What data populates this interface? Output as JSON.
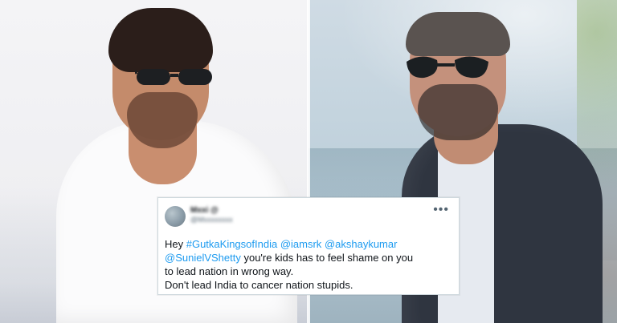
{
  "tweet": {
    "author_name": "Mxxi @",
    "author_handle": "@Mxxxxxxxx",
    "more_menu": "•••",
    "line1": {
      "prefix": "Hey ",
      "hashtag": "#GutkaKingsofIndia",
      "sep1": " ",
      "mention1": "@iamsrk",
      "sep2": " ",
      "mention2": "@akshaykumar"
    },
    "line2": {
      "mention": "@SunielVShetty",
      "rest": "  you're kids has to feel shame on you"
    },
    "line3": "to lead nation in wrong way.",
    "line4": "Don't lead India to cancer nation stupids."
  },
  "colors": {
    "link_blue": "#1d9bf0",
    "text_dark": "#0f1419",
    "text_gray": "#536471",
    "card_border": "#cfd9de"
  },
  "icons": {
    "more": "more-horizontal-icon",
    "avatar": "avatar-image"
  }
}
